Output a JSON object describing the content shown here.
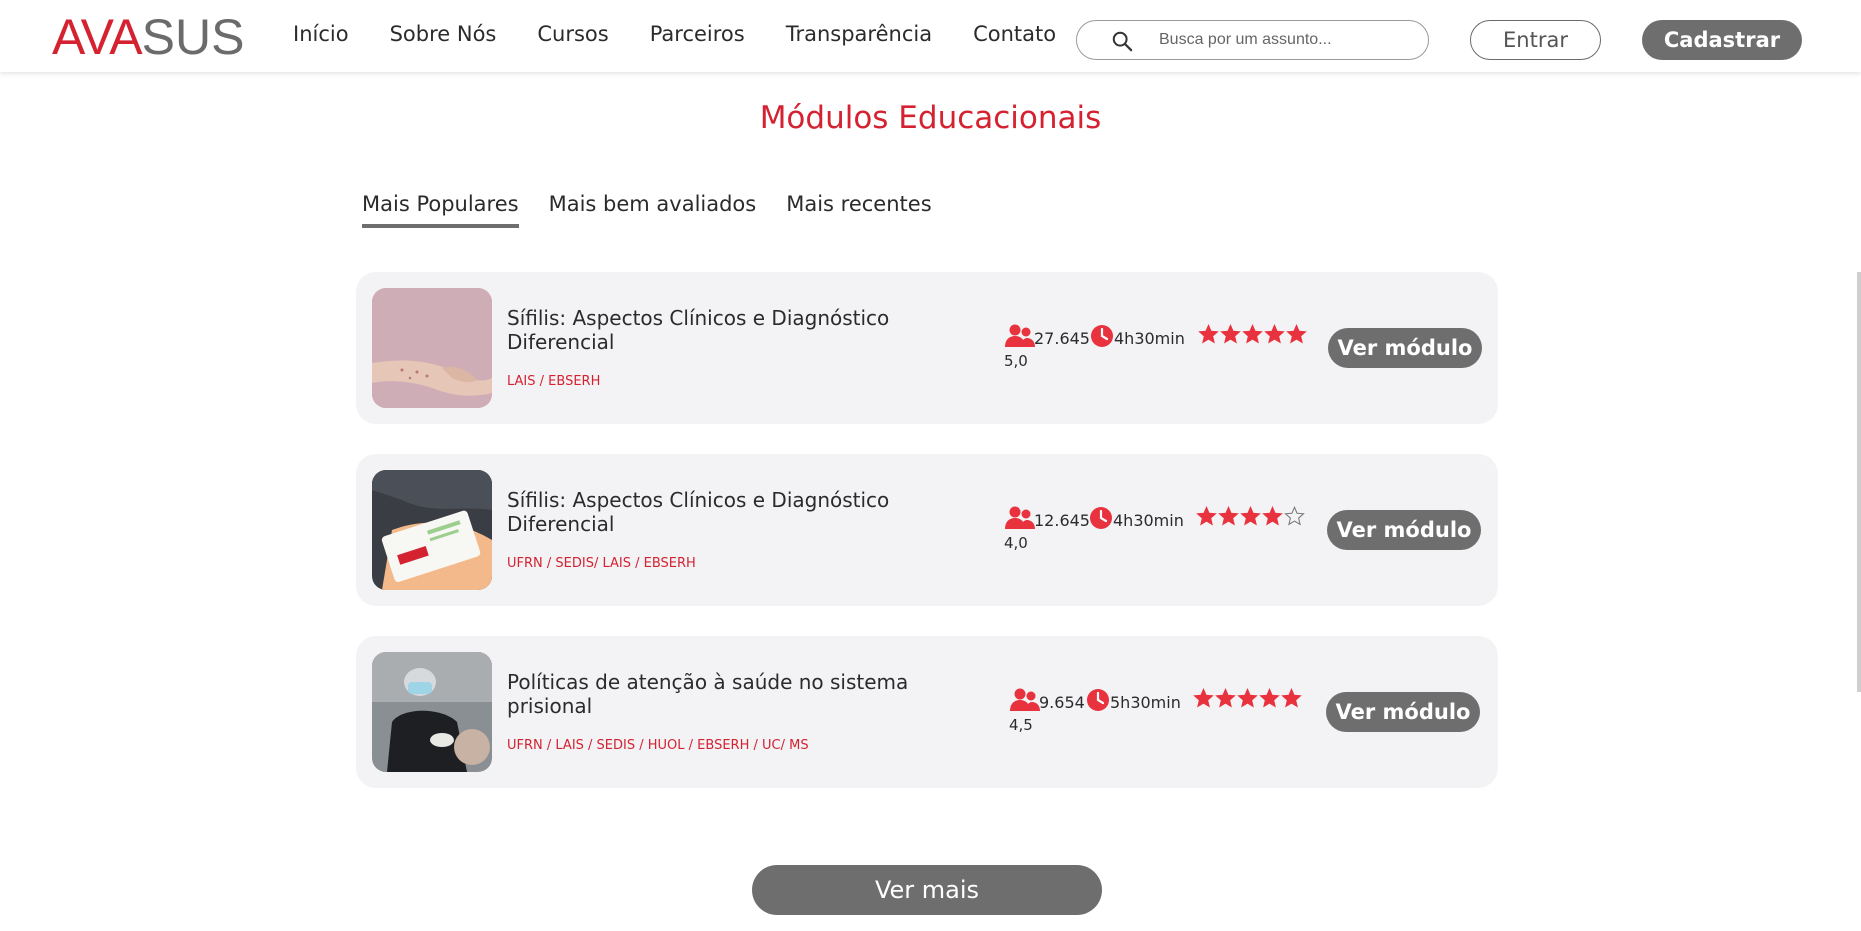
{
  "header": {
    "logo_ava": "AVA",
    "logo_sus": "SUS",
    "nav": [
      "Início",
      "Sobre Nós",
      "Cursos",
      "Parceiros",
      "Transparência",
      "Contato"
    ],
    "search_placeholder": "Busca por um assunto...",
    "login_label": "Entrar",
    "register_label": "Cadastrar"
  },
  "section": {
    "title": "Módulos Educacionais",
    "tabs": [
      "Mais Populares",
      "Mais bem avaliados",
      "Mais recentes"
    ],
    "active_tab": "Mais Populares"
  },
  "modules": [
    {
      "title": "Sífilis: Aspectos Clínicos e Diagnóstico Diferencial",
      "org": "LAIS / EBSERH",
      "students": "27.645",
      "duration": "4h30min",
      "rating": "5,0",
      "stars": 5,
      "button": "Ver módulo"
    },
    {
      "title": "Sífilis: Aspectos Clínicos e Diagnóstico Diferencial",
      "org": "UFRN / SEDIS/ LAIS / EBSERH",
      "students": "12.645",
      "duration": "4h30min",
      "rating": "4,0",
      "stars": 4,
      "button": "Ver módulo"
    },
    {
      "title": "Políticas de atenção à saúde no sistema prisional",
      "org": "UFRN / LAIS / SEDIS / HUOL / EBSERH / UC/ MS",
      "students": "9.654",
      "duration": "5h30min",
      "rating": "4,5",
      "stars": 5,
      "button": "Ver módulo"
    }
  ],
  "more_label": "Ver mais",
  "colors": {
    "brand_red": "#d42231",
    "button_gray": "#6e6e6e",
    "card_bg": "#f3f3f5"
  }
}
